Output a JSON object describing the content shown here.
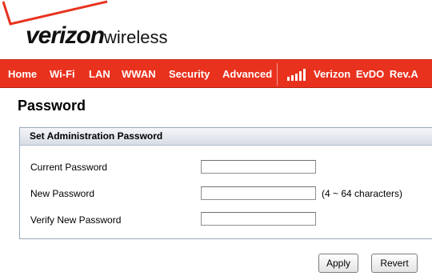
{
  "brand": {
    "logo_bold": "verizon",
    "logo_light": "wireless",
    "accent_color": "#e8321e"
  },
  "nav": {
    "items": [
      {
        "label": "Home"
      },
      {
        "label": "Wi-Fi"
      },
      {
        "label": "LAN"
      },
      {
        "label": "WWAN"
      },
      {
        "label": "Security"
      },
      {
        "label": "Advanced"
      }
    ],
    "signal_icon": "signal-bars-icon",
    "carrier_status": "Verizon EvDO Rev.A"
  },
  "page": {
    "title": "Password"
  },
  "panel": {
    "heading": "Set Administration Password",
    "fields": [
      {
        "label": "Current Password",
        "value": "",
        "hint": ""
      },
      {
        "label": "New Password",
        "value": "",
        "hint": "(4 ~ 64 characters)"
      },
      {
        "label": "Verify New Password",
        "value": "",
        "hint": ""
      }
    ]
  },
  "actions": {
    "apply_label": "Apply",
    "revert_label": "Revert"
  }
}
